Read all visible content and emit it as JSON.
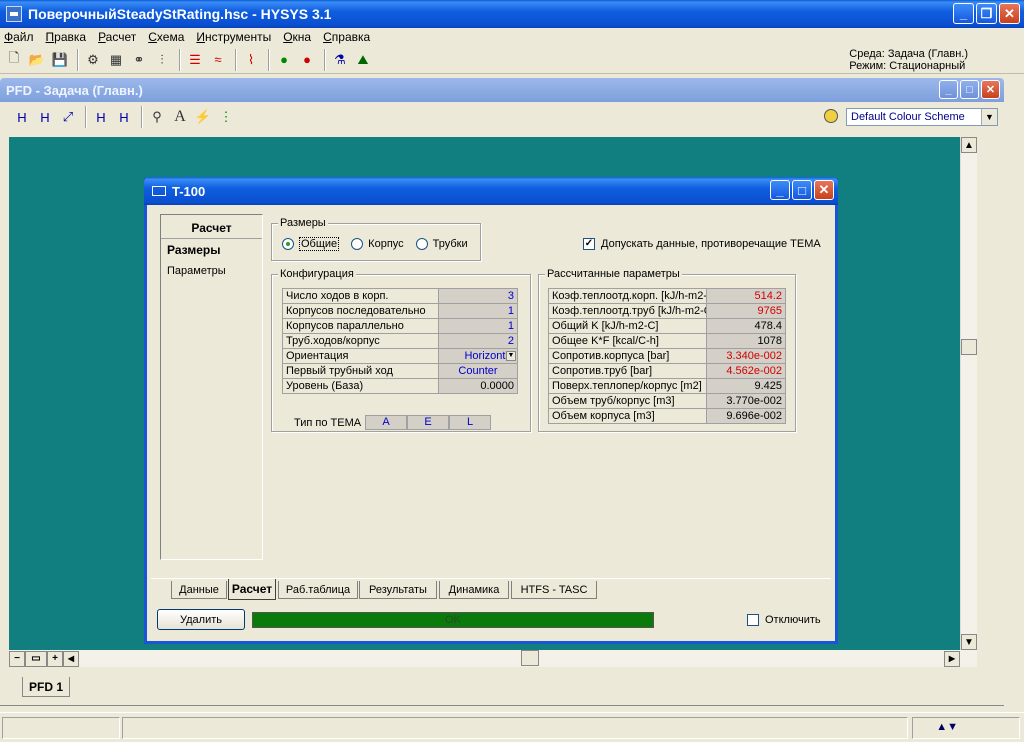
{
  "app": {
    "title": "ПоверочныйSteadyStRating.hsc - HYSYS 3.1",
    "menu": [
      "Файл",
      "Правка",
      "Расчет",
      "Схема",
      "Инструменты",
      "Окна",
      "Справка"
    ],
    "environment": "Среда: Задача (Главн.)",
    "mode": "Режим: Стационарный"
  },
  "pfd": {
    "title": "PFD - Задача (Главн.)",
    "colour_scheme": "Default Colour Scheme",
    "tab": "PFD 1"
  },
  "dialog": {
    "title": "T-100",
    "side_panel": {
      "header": "Расчет",
      "items": [
        "Размеры",
        "Параметры"
      ],
      "active": "Размеры"
    },
    "sizes_group": {
      "title": "Размеры",
      "options": [
        "Общие",
        "Корпус",
        "Трубки"
      ],
      "selected": "Общие"
    },
    "allow_tema": {
      "label": "Допускать данные, противоречащие TEMA",
      "checked": true
    },
    "configuration": {
      "title": "Конфигурация",
      "rows": [
        {
          "label": "Число ходов в корп.",
          "value": "3"
        },
        {
          "label": "Корпусов последовательно",
          "value": "1"
        },
        {
          "label": "Корпусов параллельно",
          "value": "1"
        },
        {
          "label": "Труб.ходов/корпус",
          "value": "2"
        },
        {
          "label": "Ориентация",
          "value": "Horizontal"
        },
        {
          "label": "Первый трубный ход",
          "value": "Counter"
        },
        {
          "label": "Уровень (База)",
          "value": "0.0000"
        }
      ],
      "tema_label": "Тип по TEMA",
      "tema_values": [
        "A",
        "E",
        "L"
      ]
    },
    "calculated": {
      "title": "Рассчитанные параметры",
      "rows": [
        {
          "label": "Коэф.теплоотд.корп. [kJ/h-m2-",
          "value": "514.2",
          "color": "red"
        },
        {
          "label": "Коэф.теплоотд.труб [kJ/h-m2-C",
          "value": "9765",
          "color": "red"
        },
        {
          "label": "Общий K [kJ/h-m2-C]",
          "value": "478.4",
          "color": "black"
        },
        {
          "label": "Общее K*F [kcal/C-h]",
          "value": "1078",
          "color": "black"
        },
        {
          "label": "Сопротив.корпуса [bar]",
          "value": "3.340e-002",
          "color": "red"
        },
        {
          "label": "Сопротив.труб [bar]",
          "value": "4.562e-002",
          "color": "red"
        },
        {
          "label": "Поверх.теплопер/корпус [m2]",
          "value": "9.425",
          "color": "black"
        },
        {
          "label": "Объем труб/корпус [m3]",
          "value": "3.770e-002",
          "color": "black"
        },
        {
          "label": "Объем корпуса [m3]",
          "value": "9.696e-002",
          "color": "black"
        }
      ]
    },
    "tabs": [
      "Данные",
      "Расчет",
      "Раб.таблица",
      "Результаты",
      "Динамика",
      "HTFS - TASC"
    ],
    "active_tab": "Расчет",
    "delete_button": "Удалить",
    "status": "OK",
    "ignore_label": "Отключить",
    "ignore_checked": false
  }
}
